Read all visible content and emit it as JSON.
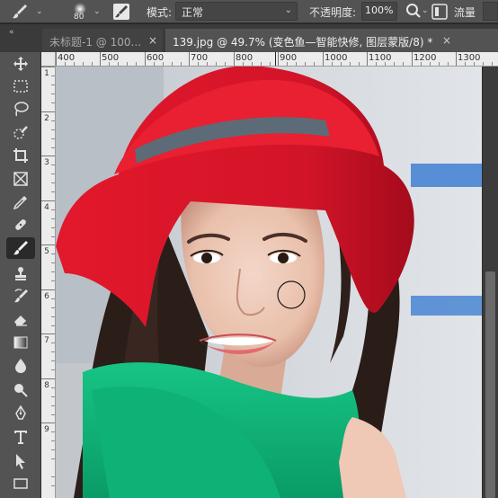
{
  "options_bar": {
    "tool_icon": "brush-icon",
    "brush_size": "80",
    "brush_panel_icon": "brush-settings-icon",
    "mode_label": "模式:",
    "mode_value": "正常",
    "opacity_label": "不透明度:",
    "opacity_value": "100%",
    "pressure_icon": "pressure-opacity-icon",
    "flow_label": "流量"
  },
  "tabs": [
    {
      "label": "未标题-1 @ 100...",
      "close": "×",
      "active": false
    },
    {
      "label": "139.jpg @ 49.7% (变色鱼—智能快修, 图层蒙版/8) *",
      "close": "×",
      "active": true
    }
  ],
  "collapse_glyph": "«",
  "toolbar": {
    "tools": [
      {
        "name": "move-tool-icon"
      },
      {
        "name": "marquee-tool-icon"
      },
      {
        "name": "lasso-tool-icon"
      },
      {
        "name": "quick-selection-tool-icon"
      },
      {
        "name": "crop-tool-icon"
      },
      {
        "name": "frame-tool-icon"
      },
      {
        "name": "eyedropper-tool-icon"
      },
      {
        "name": "healing-brush-tool-icon"
      },
      {
        "name": "brush-tool-icon",
        "active": true
      },
      {
        "name": "clone-stamp-tool-icon"
      },
      {
        "name": "history-brush-tool-icon"
      },
      {
        "name": "eraser-tool-icon"
      },
      {
        "name": "gradient-tool-icon"
      },
      {
        "name": "blur-tool-icon"
      },
      {
        "name": "dodge-tool-icon"
      },
      {
        "name": "pen-tool-icon"
      },
      {
        "name": "type-tool-icon"
      },
      {
        "name": "path-selection-tool-icon"
      },
      {
        "name": "rectangle-tool-icon"
      }
    ]
  },
  "ruler": {
    "top_labels": [
      "400",
      "500",
      "600",
      "700",
      "800",
      "900",
      "1000",
      "1100",
      "1200",
      "1300"
    ],
    "left_labels": [
      "1",
      "2",
      "3",
      "4",
      "5",
      "6",
      "7",
      "8",
      "9"
    ]
  },
  "colors": {
    "ui_dark": "#282828",
    "panel": "#535353",
    "hat_red": "#e3182c",
    "scarf_green": "#0fb276",
    "accent_blue": "#3f7fd1"
  }
}
